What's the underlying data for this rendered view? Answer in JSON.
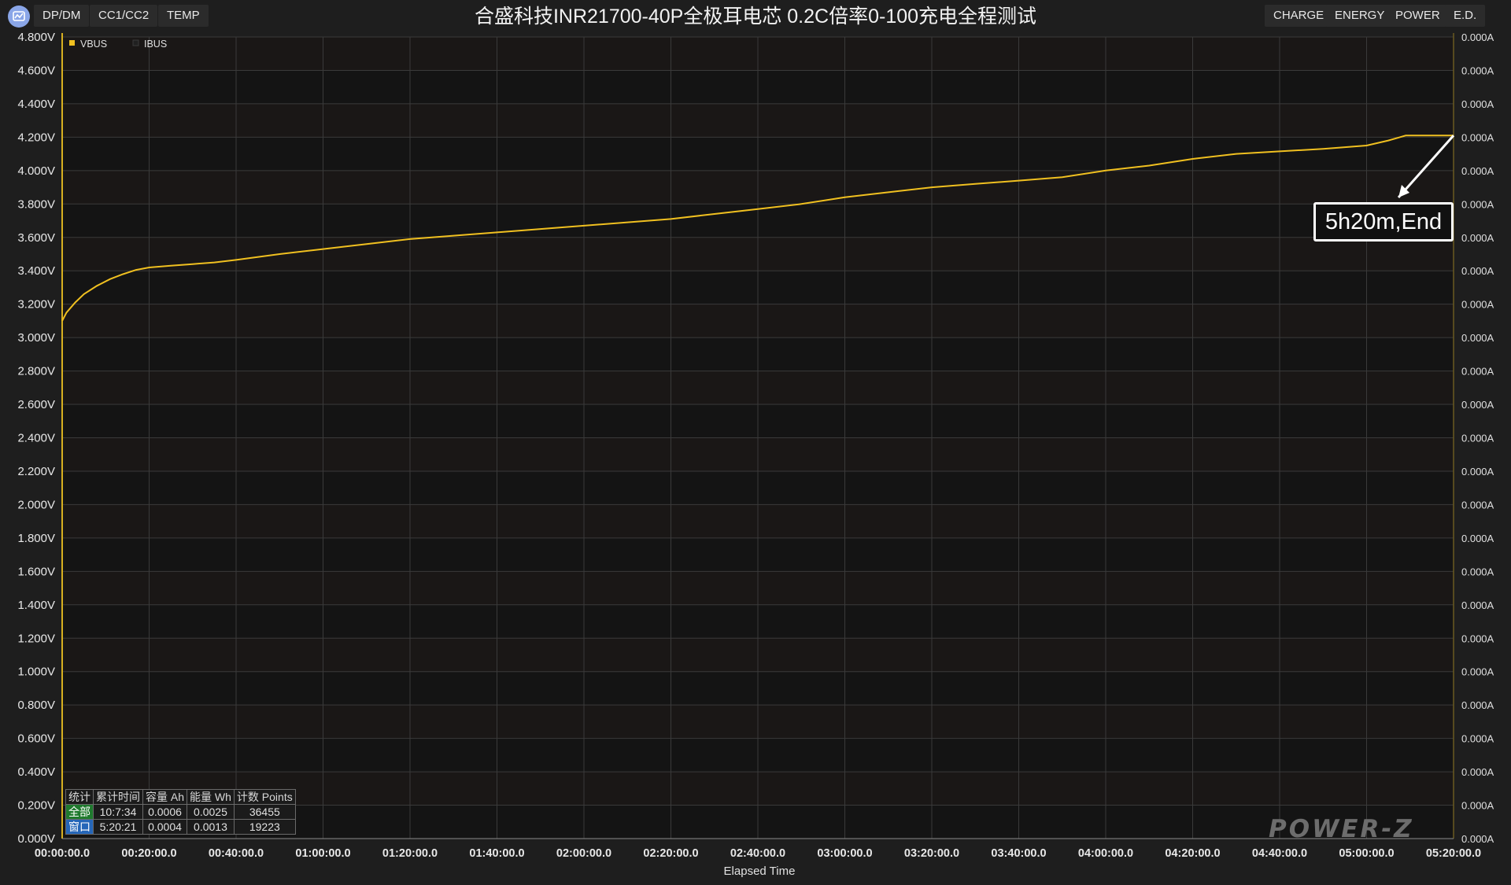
{
  "toolbar": {
    "left_tabs": [
      "DP/DM",
      "CC1/CC2",
      "TEMP"
    ],
    "right_tabs": [
      "CHARGE",
      "ENERGY",
      "POWER",
      "E.D."
    ]
  },
  "colors": {
    "background": "#1e1e1e",
    "plot_background": "#141414",
    "vbus_line": "#f0c020",
    "grid": "#3a3a3a"
  },
  "annotation": {
    "text": "5h20m,End"
  },
  "stats_table": {
    "headers": [
      "统计",
      "累计时间",
      "容量 Ah",
      "能量 Wh",
      "计数 Points"
    ],
    "rows": [
      {
        "label": "全部",
        "time": "10:7:34",
        "capacity": "0.0006",
        "energy": "0.0025",
        "points": "36455"
      },
      {
        "label": "窗口",
        "time": "5:20:21",
        "capacity": "0.0004",
        "energy": "0.0013",
        "points": "19223"
      }
    ]
  },
  "watermark": "POWER-Z",
  "chart_data": {
    "type": "line",
    "title": "合盛科技INR21700-40P全极耳电芯 0.2C倍率0-100充电全程测试",
    "xlabel": "Elapsed Time",
    "ylabel_left": "",
    "ylabel_right": "",
    "x_unit": "minutes",
    "xlim": [
      0,
      320
    ],
    "ylim": [
      0,
      4.8
    ],
    "y2lim": [
      0,
      4.8
    ],
    "grid": true,
    "legend_position": "top-left",
    "x_ticks": [
      "00:00:00.0",
      "00:20:00.0",
      "00:40:00.0",
      "01:00:00.0",
      "01:20:00.0",
      "01:40:00.0",
      "02:00:00.0",
      "02:20:00.0",
      "02:40:00.0",
      "03:00:00.0",
      "03:20:00.0",
      "03:40:00.0",
      "04:00:00.0",
      "04:20:00.0",
      "04:40:00.0",
      "05:00:00.0",
      "05:20:00.0"
    ],
    "y_ticks": [
      "4.800V",
      "4.600V",
      "4.400V",
      "4.200V",
      "4.000V",
      "3.800V",
      "3.600V",
      "3.400V",
      "3.200V",
      "3.000V",
      "2.800V",
      "2.600V",
      "2.400V",
      "2.200V",
      "2.000V",
      "1.800V",
      "1.600V",
      "1.400V",
      "1.200V",
      "1.000V",
      "0.800V",
      "0.600V",
      "0.400V",
      "0.200V",
      "0.000V"
    ],
    "y2_ticks": [
      "0.000A",
      "0.000A",
      "0.000A",
      "0.000A",
      "0.000A",
      "0.000A",
      "0.000A",
      "0.000A",
      "0.000A",
      "0.000A",
      "0.000A",
      "0.000A",
      "0.000A",
      "0.000A",
      "0.000A",
      "0.000A",
      "0.000A",
      "0.000A",
      "0.000A",
      "0.000A",
      "0.000A",
      "0.000A",
      "0.000A",
      "0.000A",
      "0.000A"
    ],
    "series": [
      {
        "name": "VBUS",
        "color": "#f0c020",
        "x": [
          0,
          1,
          3,
          5,
          8,
          11,
          14,
          17,
          20,
          25,
          30,
          35,
          40,
          50,
          60,
          70,
          80,
          90,
          100,
          110,
          120,
          130,
          140,
          150,
          160,
          170,
          180,
          190,
          200,
          210,
          220,
          230,
          240,
          250,
          260,
          270,
          280,
          290,
          300,
          305,
          309,
          312,
          316,
          320
        ],
        "y": [
          3.1,
          3.15,
          3.21,
          3.26,
          3.31,
          3.35,
          3.38,
          3.405,
          3.42,
          3.43,
          3.44,
          3.45,
          3.465,
          3.5,
          3.53,
          3.56,
          3.59,
          3.61,
          3.63,
          3.65,
          3.67,
          3.69,
          3.71,
          3.74,
          3.77,
          3.8,
          3.84,
          3.87,
          3.9,
          3.92,
          3.94,
          3.96,
          4.0,
          4.03,
          4.07,
          4.1,
          4.115,
          4.13,
          4.15,
          4.18,
          4.21,
          4.21,
          4.21,
          4.21
        ]
      },
      {
        "name": "IBUS",
        "color": "#202020",
        "x": [],
        "y": []
      }
    ]
  }
}
